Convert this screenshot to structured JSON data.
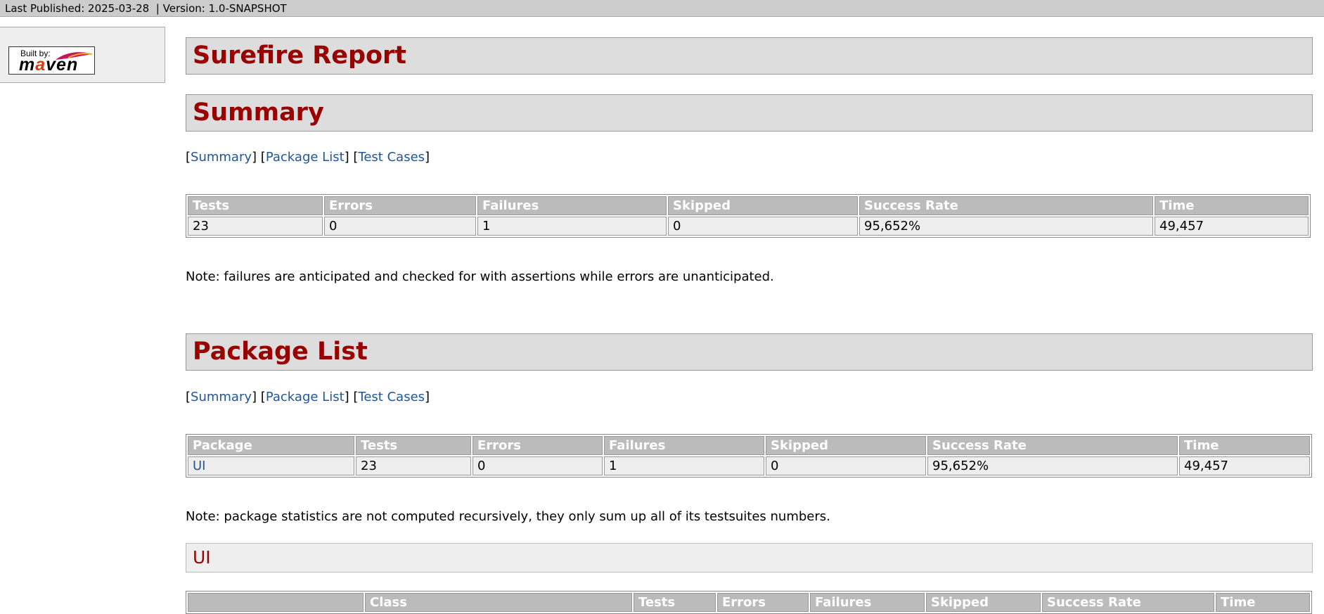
{
  "topbar": {
    "last_published": "Last Published: 2025-03-28",
    "separator": "|",
    "version": "Version: 1.0-SNAPSHOT"
  },
  "logo": {
    "built_by": "Built by:",
    "maven_m": "m",
    "maven_a": "a",
    "maven_ven": "ven"
  },
  "report_title": "Surefire Report",
  "nav": {
    "open": "[",
    "close": "]",
    "summary": "Summary",
    "package_list": "Package List",
    "test_cases": "Test Cases"
  },
  "summary": {
    "title": "Summary",
    "headers": [
      "Tests",
      "Errors",
      "Failures",
      "Skipped",
      "Success Rate",
      "Time"
    ],
    "row": [
      "23",
      "0",
      "1",
      "0",
      "95,652%",
      "49,457"
    ],
    "note": "Note: failures are anticipated and checked for with assertions while errors are unanticipated."
  },
  "package_list": {
    "title": "Package List",
    "headers": [
      "Package",
      "Tests",
      "Errors",
      "Failures",
      "Skipped",
      "Success Rate",
      "Time"
    ],
    "row": [
      "UI",
      "23",
      "0",
      "1",
      "0",
      "95,652%",
      "49,457"
    ],
    "note": "Note: package statistics are not computed recursively, they only sum up all of its testsuites numbers."
  },
  "ui_section": {
    "title": "UI",
    "headers": [
      "",
      "Class",
      "Tests",
      "Errors",
      "Failures",
      "Skipped",
      "Success Rate",
      "Time"
    ]
  }
}
